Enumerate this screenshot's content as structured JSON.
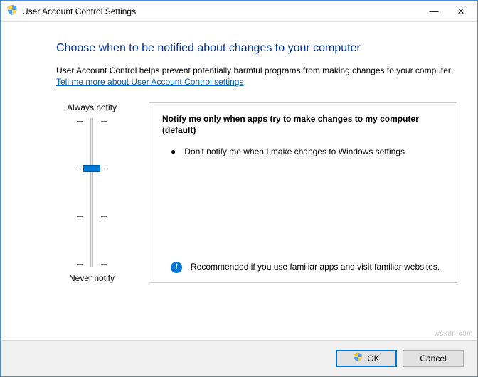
{
  "window": {
    "title": "User Account Control Settings",
    "minimize_glyph": "—",
    "close_glyph": "✕"
  },
  "heading": "Choose when to be notified about changes to your computer",
  "description": "User Account Control helps prevent potentially harmful programs from making changes to your computer.",
  "help_link": "Tell me more about User Account Control settings",
  "slider": {
    "top_label": "Always notify",
    "bottom_label": "Never notify",
    "levels": 4,
    "current_index": 1
  },
  "detail": {
    "title": "Notify me only when apps try to make changes to my computer (default)",
    "bullet": "Don't notify me when I make changes to Windows settings",
    "recommendation": "Recommended if you use familiar apps and visit familiar websites.",
    "info_glyph": "i"
  },
  "buttons": {
    "ok": "OK",
    "cancel": "Cancel"
  },
  "watermark": "wsxdn.com"
}
